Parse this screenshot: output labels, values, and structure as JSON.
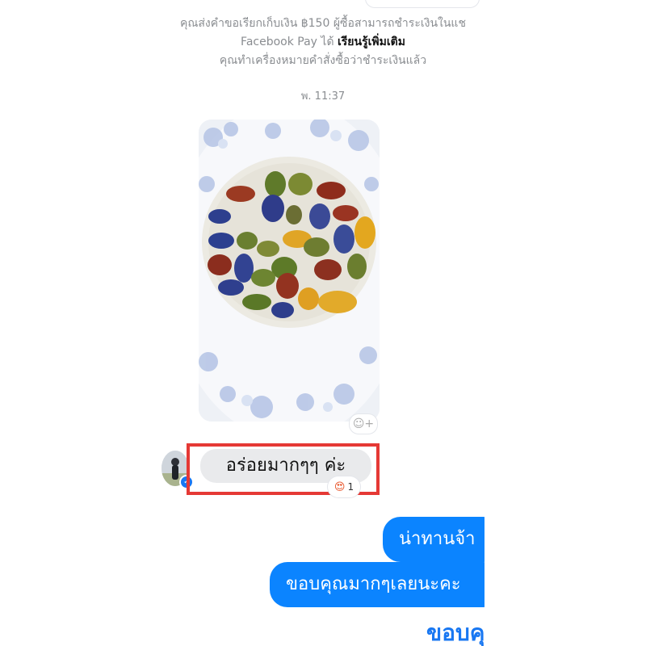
{
  "chat": {
    "notice": {
      "line1": "คุณส่งคำขอเรียกเก็บเงิน ฿150 ผู้ซื้อสามารถชำระเงินในแช",
      "line2_prefix": "Facebook Pay ได้",
      "line2_link": "เรียนรู้เพิ่มเติม",
      "line3": "คุณทำเครื่องหมายคำสั่งซื้อว่าชำระเงินแล้ว"
    },
    "timestamp": "พ. 11:37",
    "add_reaction_icon": "smiley-plus-icon",
    "received_message": {
      "text": "อร่อยมากๆๆ ค่ะ",
      "reaction_icon": "heart-eyes-emoji-icon",
      "reaction_count": "1",
      "highlight_color": "#e53935"
    },
    "sent_messages": [
      {
        "text": "น่าทานจ้า"
      },
      {
        "text": "ขอบคุณมากๆเลยนะคะ"
      },
      {
        "text": "ขอบคุ"
      }
    ],
    "colors": {
      "sent_bubble": "#0b84ff",
      "received_bubble": "#e9eaec",
      "meta_text": "#8a8d91"
    }
  }
}
